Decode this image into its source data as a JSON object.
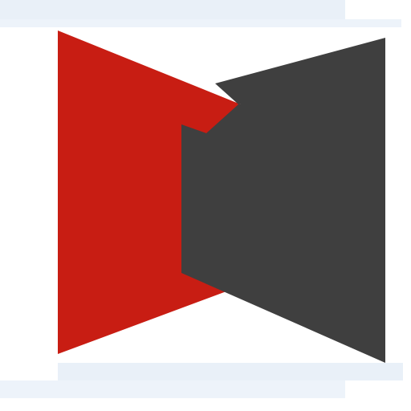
{
  "logo": {
    "name": "interlocking-frames-logo",
    "colors": {
      "red": "#c81d13",
      "dark": "#3f3f3f",
      "background": "#ffffff",
      "band": "#e9f0f8"
    }
  }
}
